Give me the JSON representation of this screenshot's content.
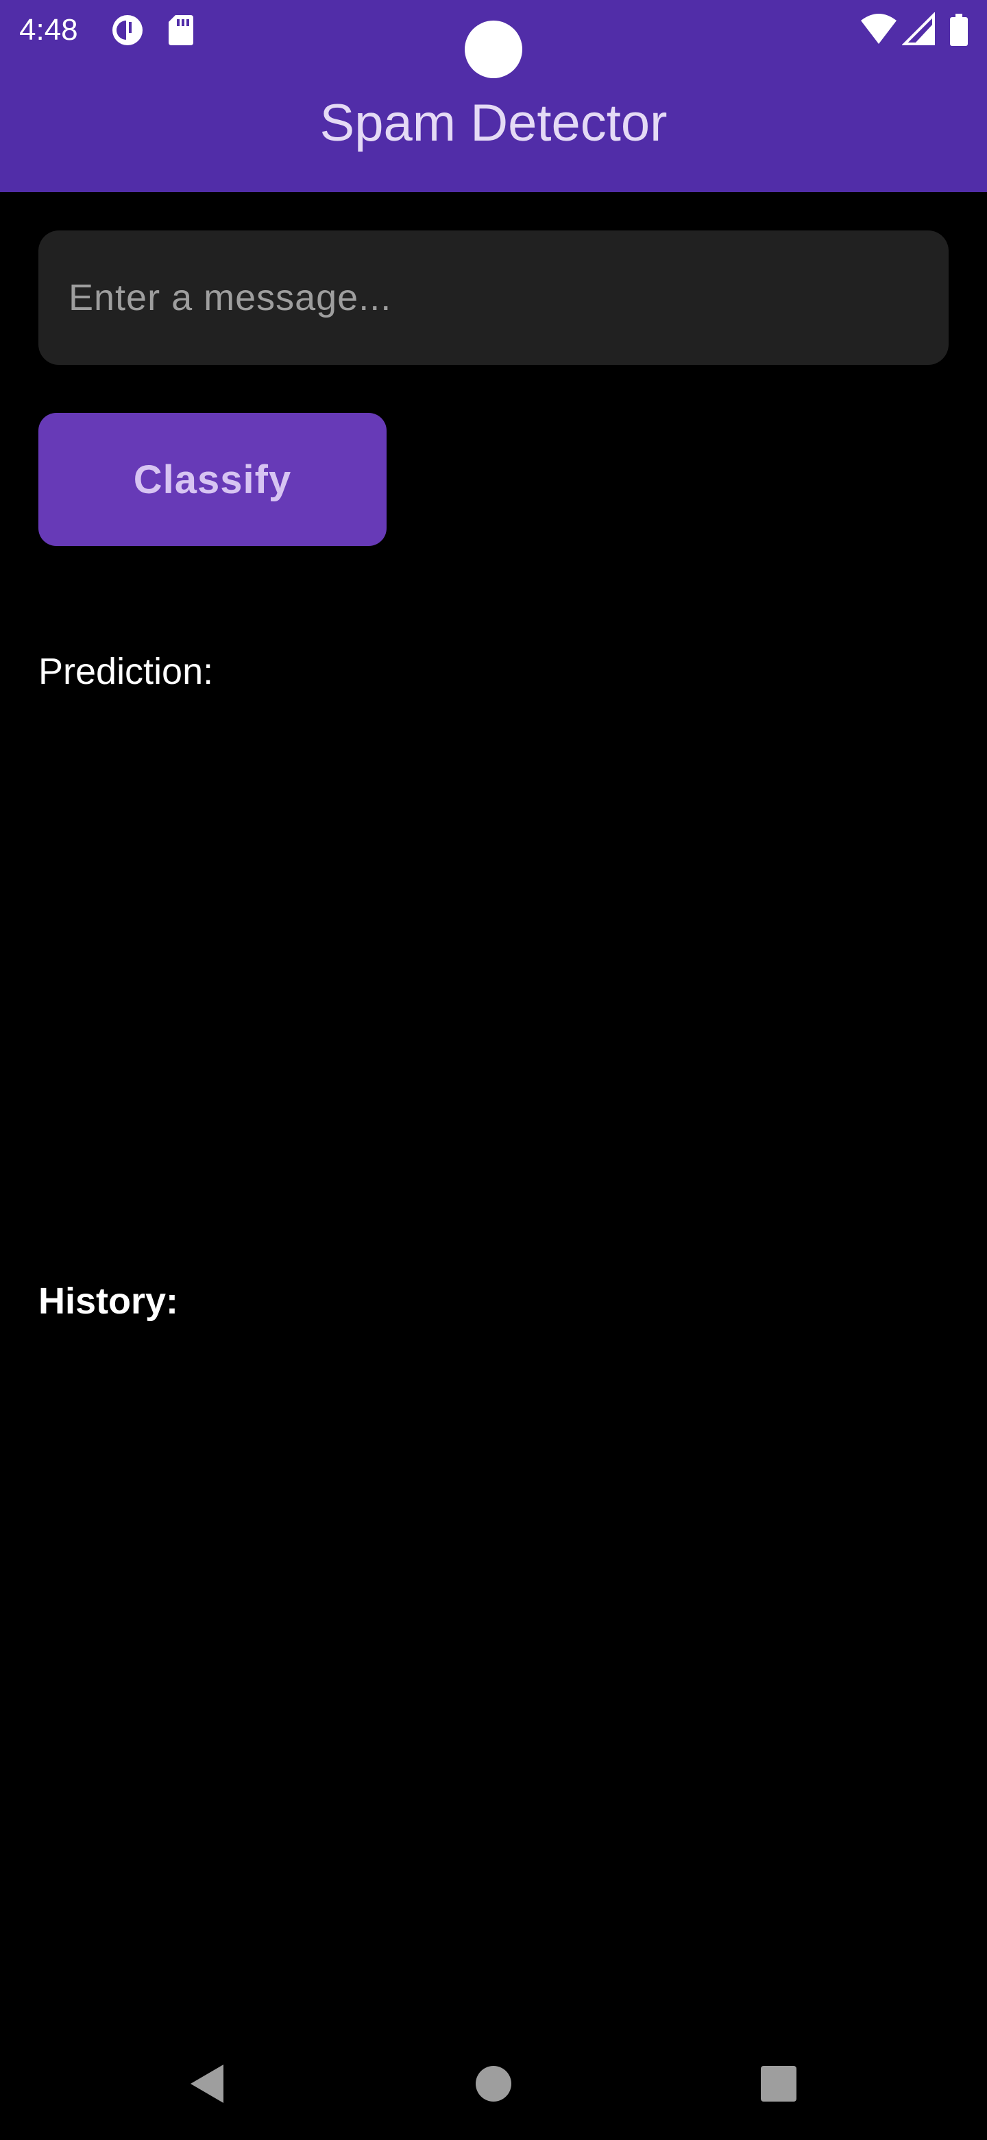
{
  "status_bar": {
    "time": "4:48",
    "left_icons": [
      "data-saver-icon",
      "sd-card-icon"
    ],
    "right_icons": [
      "wifi-icon",
      "cellular-signal-icon",
      "battery-icon"
    ]
  },
  "app_bar": {
    "title": "Spam Detector",
    "color": "#512DA8"
  },
  "message_input": {
    "value": "",
    "placeholder": "Enter a message..."
  },
  "classify_button": {
    "label": "Classify",
    "color": "#673AB7"
  },
  "prediction": {
    "label": "Prediction:"
  },
  "history": {
    "label": "History:"
  },
  "nav_bar": {
    "buttons": [
      "back-icon",
      "home-icon",
      "recents-icon"
    ]
  }
}
